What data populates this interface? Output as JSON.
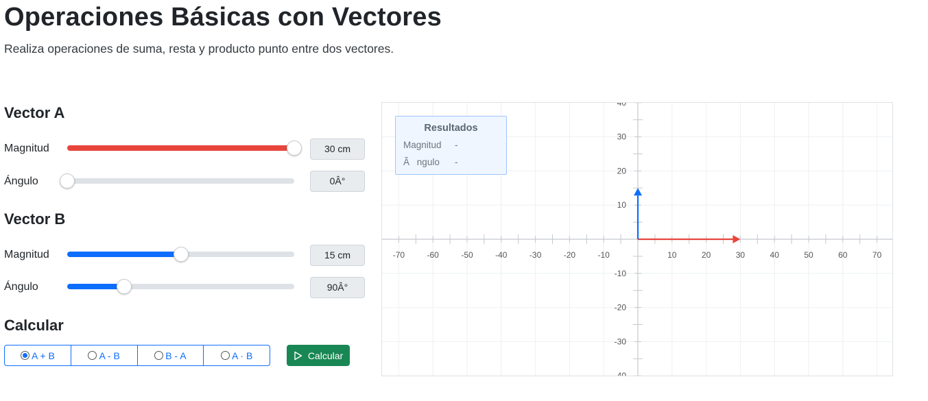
{
  "page": {
    "title": "Operaciones Básicas con Vectores",
    "subtitle": "Realiza operaciones de suma, resta y producto punto entre dos vectores."
  },
  "vector_a": {
    "title": "Vector A",
    "magnitude_label": "Magnitud",
    "magnitude_value": "30 cm",
    "magnitude_fraction": 1.0,
    "angle_label": "Ángulo",
    "angle_value": "0Â°",
    "angle_fraction": 0.0,
    "color": "#e8453c"
  },
  "vector_b": {
    "title": "Vector B",
    "magnitude_label": "Magnitud",
    "magnitude_value": "15 cm",
    "magnitude_fraction": 0.5,
    "angle_label": "Ángulo",
    "angle_value": "90Â°",
    "angle_fraction": 0.25,
    "color": "#0d6efd"
  },
  "calculate": {
    "title": "Calcular",
    "operations": [
      {
        "label": "A + B",
        "checked": true
      },
      {
        "label": "A - B",
        "checked": false
      },
      {
        "label": "B - A",
        "checked": false
      },
      {
        "label": "A · B",
        "checked": false
      }
    ],
    "button_label": "Calcular",
    "button_color": "#198754"
  },
  "results": {
    "title": "Resultados",
    "magnitude_label": "Magnitud",
    "magnitude_value": "-",
    "angle_label": "Ãngulo",
    "angle_value": "-"
  },
  "chart_data": {
    "type": "scatter",
    "x_ticks": [
      -70,
      -60,
      -50,
      -40,
      -30,
      -20,
      -10,
      10,
      20,
      30,
      40,
      50,
      60,
      70
    ],
    "y_ticks": [
      40,
      30,
      20,
      10,
      -10,
      -20,
      -30,
      -40
    ],
    "xlim": [
      -75,
      75
    ],
    "ylim": [
      -40,
      40
    ],
    "grid": true,
    "vectors": [
      {
        "x0": 0,
        "y0": 0,
        "x1": 30,
        "y1": 0,
        "color": "#e8453c"
      },
      {
        "x0": 0,
        "y0": 0,
        "x1": 0,
        "y1": 15,
        "color": "#0d6efd"
      }
    ]
  }
}
